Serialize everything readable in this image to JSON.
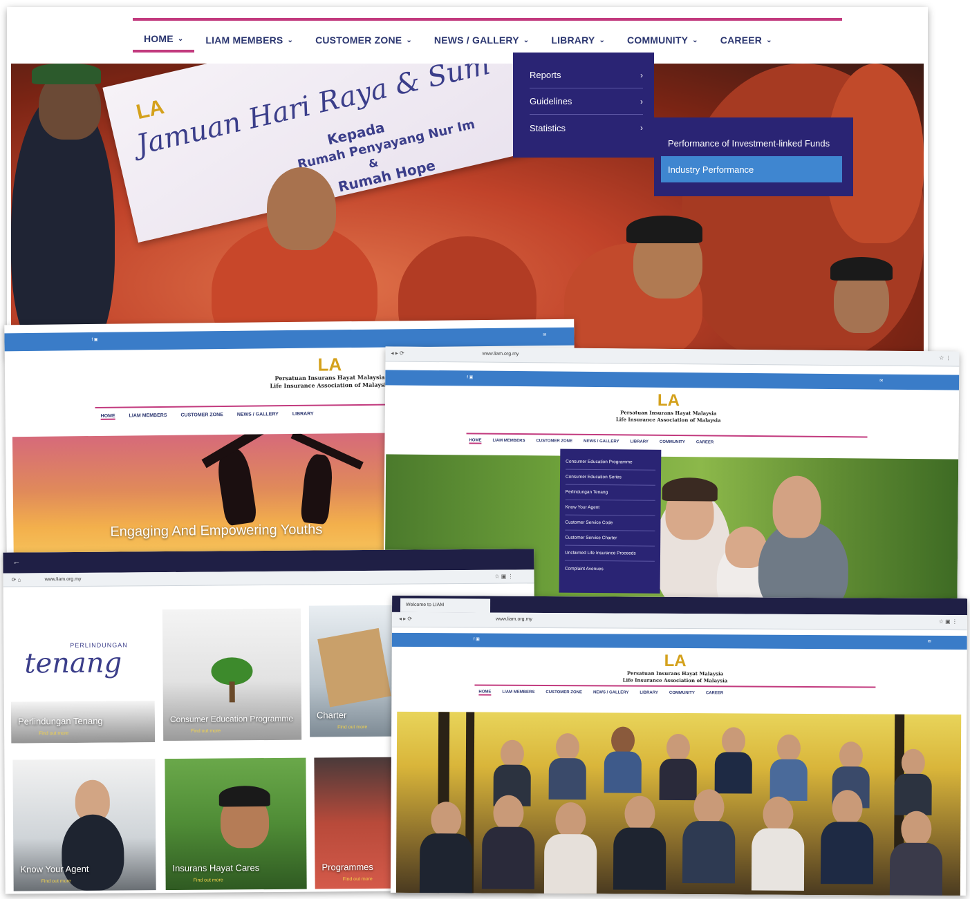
{
  "main_site": {
    "nav": [
      {
        "label": "HOME",
        "active": true
      },
      {
        "label": "LIAM MEMBERS"
      },
      {
        "label": "CUSTOMER ZONE"
      },
      {
        "label": "NEWS / GALLERY"
      },
      {
        "label": "LIBRARY"
      },
      {
        "label": "COMMUNITY"
      },
      {
        "label": "CAREER"
      }
    ],
    "library_menu": [
      "Reports",
      "Guidelines",
      "Statistics"
    ],
    "statistics_submenu": [
      {
        "label": "Performance of Investment-linked Funds"
      },
      {
        "label": "Industry Performance",
        "selected": true
      }
    ],
    "banner": {
      "script": "Jamuan Hari Raya & Sum",
      "line1": "Kepada",
      "line2": "Rumah Penyayang Nur Im",
      "line3": "&",
      "line4": "Rumah Hope"
    }
  },
  "youth_page": {
    "association_line1": "Persatuan Insurans Hayat Malaysia",
    "association_line2": "Life Insurance Association of Malaysia",
    "nav": [
      "HOME",
      "LIAM MEMBERS",
      "CUSTOMER ZONE",
      "NEWS / GALLERY",
      "LIBRARY"
    ],
    "caption": "Engaging And Empowering Youths"
  },
  "family_page": {
    "url": "www.liam.org.my",
    "association_line1": "Persatuan Insurans Hayat Malaysia",
    "association_line2": "Life Insurance Association of Malaysia",
    "nav": [
      "HOME",
      "LIAM MEMBERS",
      "CUSTOMER ZONE",
      "NEWS / GALLERY",
      "LIBRARY",
      "COMMUNITY",
      "CAREER"
    ],
    "customer_zone_menu": [
      "Consumer Education Programme",
      "Consumer Education Series",
      "Perlindungan Tenang",
      "Know Your Agent",
      "Customer Service Code",
      "Customer Service Charter",
      "Unclaimed Life Insurance Proceeds",
      "Complaint Avenues"
    ]
  },
  "grid_page": {
    "url": "www.liam.org.my",
    "tenang_top": "PERLINDUNGAN",
    "tenang_word": "tenang",
    "tiles": [
      {
        "caption": "Perlindungan Tenang",
        "more": "Find out more"
      },
      {
        "caption": "Consumer Education Programme",
        "more": "Find out more"
      },
      {
        "caption": "Charter",
        "more": "Find out more"
      },
      {
        "caption": "Know Your Agent",
        "more": "Find out more"
      },
      {
        "caption": "Insurans Hayat Cares",
        "more": "Find out more"
      },
      {
        "caption": "Programmes",
        "more": "Find out more"
      }
    ]
  },
  "group_page": {
    "tab": "Welcome to LIAM",
    "url": "www.liam.org.my",
    "association_line1": "Persatuan Insurans Hayat Malaysia",
    "association_line2": "Life Insurance Association of Malaysia",
    "nav": [
      "HOME",
      "LIAM MEMBERS",
      "CUSTOMER ZONE",
      "NEWS / GALLERY",
      "LIBRARY",
      "COMMUNITY",
      "CAREER"
    ]
  },
  "colors": {
    "nav_text": "#2b3670",
    "accent_pink": "#c23a7e",
    "dropdown_bg": "#2a2474",
    "dropdown_selected": "#3f86d0",
    "topbar_blue": "#3a7cc8"
  }
}
